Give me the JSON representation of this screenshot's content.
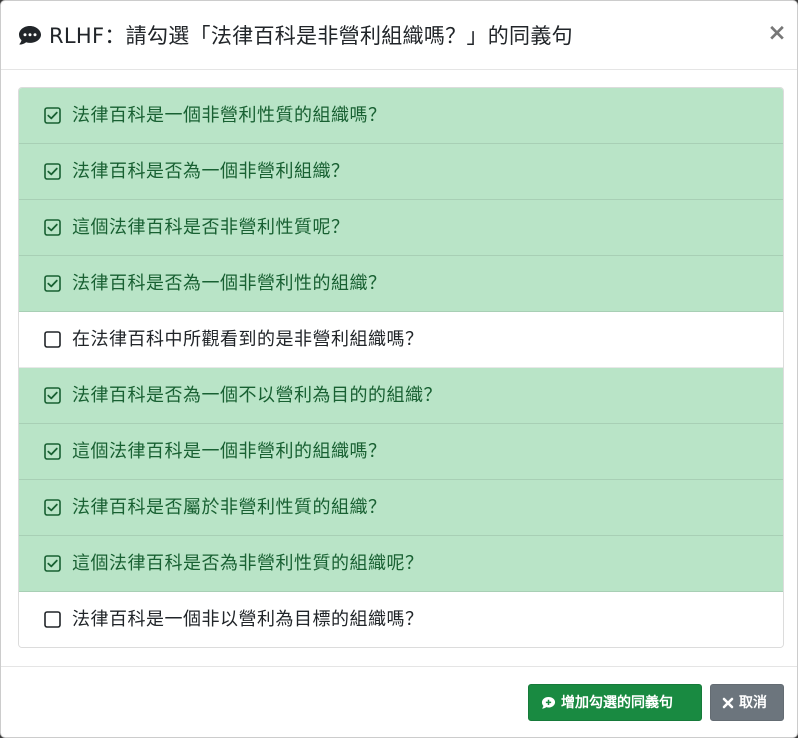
{
  "modal": {
    "title": "RLHF：請勾選「法律百科是非營利組織嗎？」的同義句",
    "title_icon": "comment-dots-icon",
    "close_label": "×"
  },
  "colors": {
    "checked_bg": "#b9e4c7",
    "checked_text": "#186032",
    "success_button": "#198a41",
    "secondary_button": "#6c757d"
  },
  "sentences": [
    {
      "text": "法律百科是一個非營利性質的組織嗎？",
      "checked": true
    },
    {
      "text": "法律百科是否為一個非營利組織？",
      "checked": true
    },
    {
      "text": "這個法律百科是否非營利性質呢？",
      "checked": true
    },
    {
      "text": "法律百科是否為一個非營利性的組織？",
      "checked": true
    },
    {
      "text": "在法律百科中所觀看到的是非營利組織嗎？",
      "checked": false
    },
    {
      "text": "法律百科是否為一個不以營利為目的的組織？",
      "checked": true
    },
    {
      "text": "這個法律百科是一個非營利的組織嗎？",
      "checked": true
    },
    {
      "text": "法律百科是否屬於非營利性質的組織？",
      "checked": true
    },
    {
      "text": "這個法律百科是否為非營利性質的組織呢？",
      "checked": true
    },
    {
      "text": "法律百科是一個非以營利為目標的組織嗎？",
      "checked": false
    }
  ],
  "footer": {
    "add_label": "增加勾選的同義句",
    "add_icon": "comment-plus-icon",
    "cancel_label": "取消",
    "cancel_icon": "close-icon"
  }
}
